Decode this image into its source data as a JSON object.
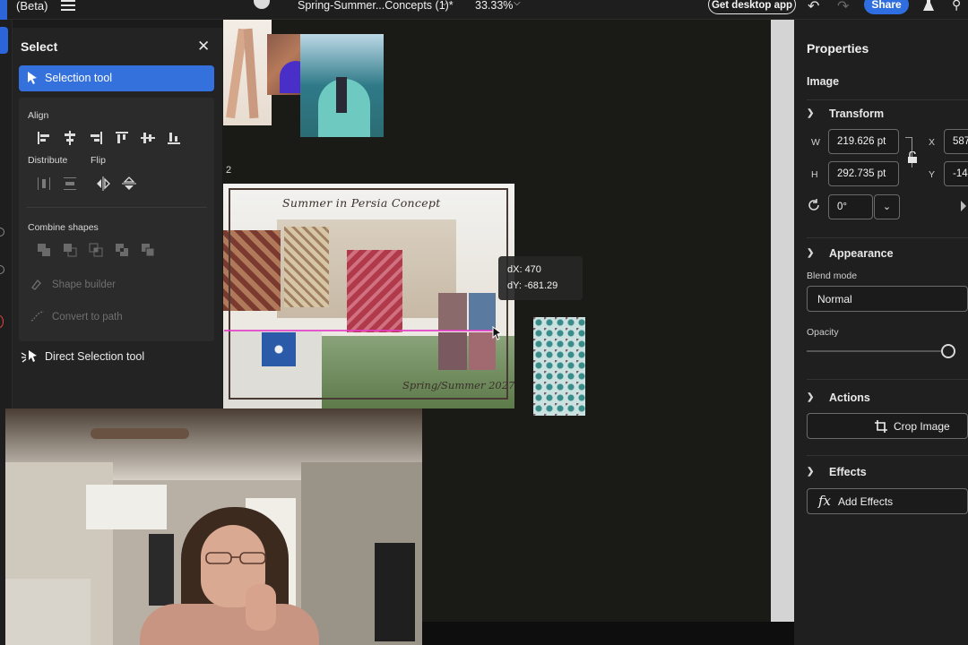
{
  "topbar": {
    "beta_label": "(Beta)",
    "document_title": "Spring-Summer...Concepts (1)*",
    "zoom": "33.33%",
    "get_app_label": "Get desktop app",
    "share_label": "Share"
  },
  "select_panel": {
    "title": "Select",
    "selection_tool_label": "Selection tool",
    "align_label": "Align",
    "distribute_label": "Distribute",
    "flip_label": "Flip",
    "combine_label": "Combine shapes",
    "shape_builder_label": "Shape builder",
    "convert_path_label": "Convert to path",
    "direct_selection_label": "Direct Selection tool"
  },
  "canvas": {
    "page_number": "2",
    "board_title": "Summer in Persia Concept",
    "board_subtitle": "Spring/Summer 2027",
    "dx_text": "dX: 470",
    "dy_text": "dY: -681.29"
  },
  "properties": {
    "title": "Properties",
    "subtitle": "Image",
    "transform_label": "Transform",
    "w_label": "W",
    "w_value": "219.626 pt",
    "h_label": "H",
    "h_value": "292.735 pt",
    "x_label": "X",
    "x_value": "587",
    "y_label": "Y",
    "y_value": "-14",
    "rotation_value": "0°",
    "appearance_label": "Appearance",
    "blend_mode_label": "Blend mode",
    "blend_mode_value": "Normal",
    "opacity_label": "Opacity",
    "opacity_level": 1.0,
    "actions_label": "Actions",
    "crop_label": "Crop Image",
    "effects_label": "Effects",
    "add_effects_label": "Add Effects",
    "fx_glyph": "fx"
  },
  "colors": {
    "accent_blue": "#3571dd",
    "guide_magenta": "#e43ec9",
    "panel_bg": "#232323"
  }
}
